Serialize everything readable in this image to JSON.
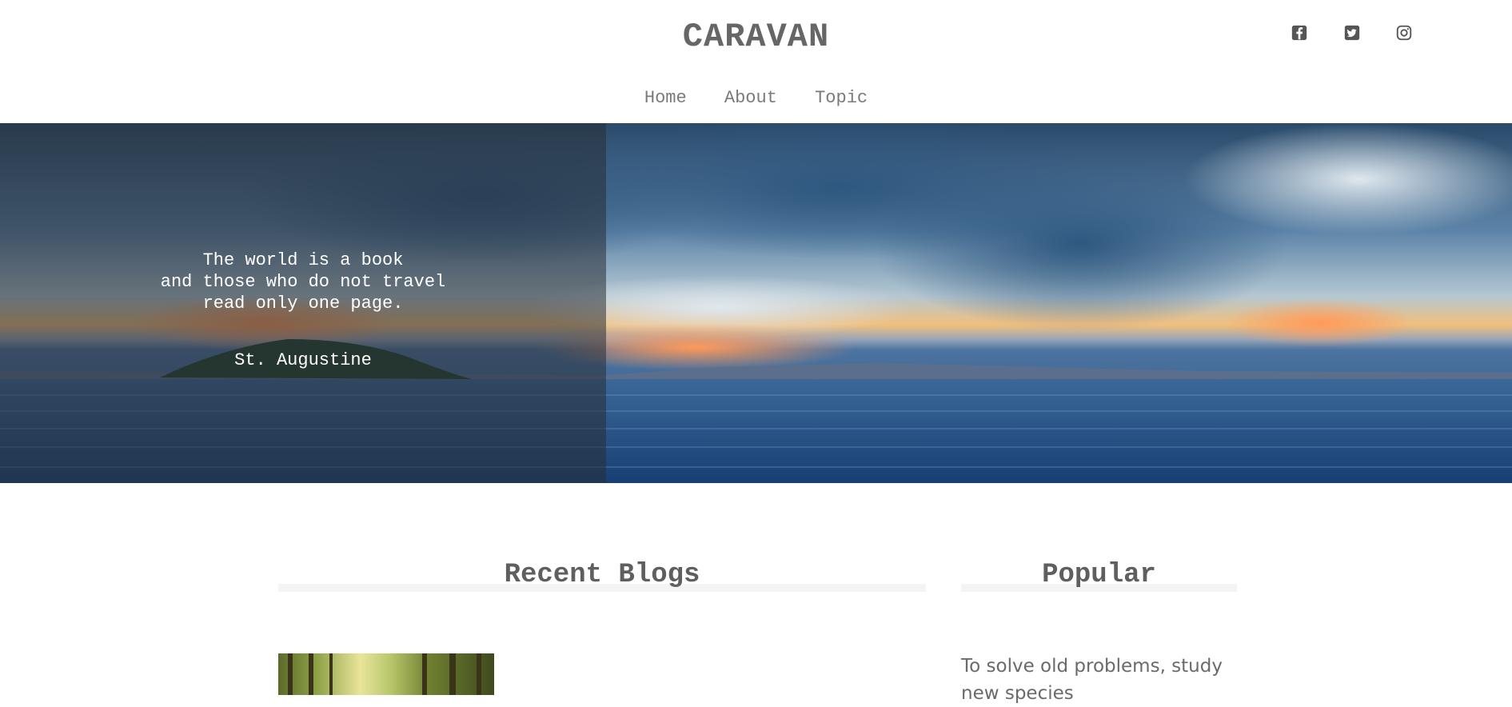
{
  "header": {
    "brand": "CARAVAN",
    "social": [
      {
        "icon": "facebook-icon",
        "label": "Facebook"
      },
      {
        "icon": "twitter-icon",
        "label": "Twitter"
      },
      {
        "icon": "instagram-icon",
        "label": "Instagram"
      }
    ],
    "nav": [
      {
        "label": "Home"
      },
      {
        "label": "About"
      },
      {
        "label": "Topic"
      }
    ]
  },
  "hero": {
    "quote_lines": [
      "The world is a book",
      "and those who do not travel",
      "read only one page."
    ],
    "author": "St. Augustine"
  },
  "main": {
    "recent_title": "Recent Blogs",
    "popular_title": "Popular",
    "popular_text": "To solve old problems, study new species"
  },
  "colors": {
    "text": "#5f5f5f",
    "nav": "#7a7a7a",
    "rule": "#f4f4f4"
  }
}
